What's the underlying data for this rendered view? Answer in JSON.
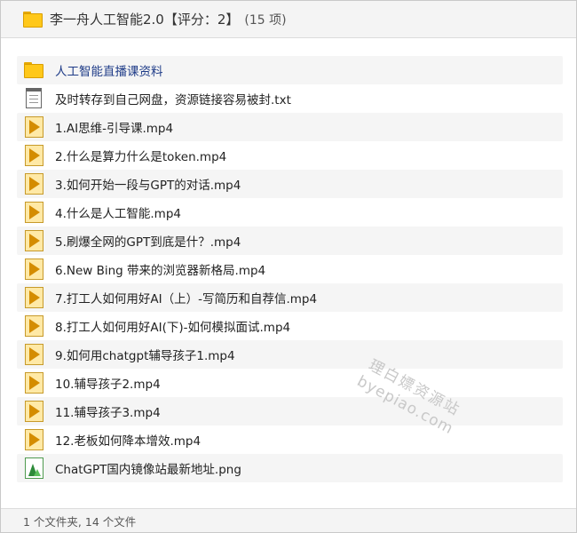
{
  "header": {
    "icon": "folder-icon",
    "title": "李一舟人工智能2.0【评分：2】",
    "count": "(15 项)"
  },
  "files": [
    {
      "name": "人工智能直播课资料",
      "type": "folder",
      "icon": "folder-icon"
    },
    {
      "name": "及时转存到自己网盘，资源链接容易被封.txt",
      "type": "txt",
      "icon": "text-file-icon"
    },
    {
      "name": "1.AI思维-引导课.mp4",
      "type": "video",
      "icon": "video-file-icon"
    },
    {
      "name": "2.什么是算力什么是token.mp4",
      "type": "video",
      "icon": "video-file-icon"
    },
    {
      "name": "3.如何开始一段与GPT的对话.mp4",
      "type": "video",
      "icon": "video-file-icon"
    },
    {
      "name": "4.什么是人工智能.mp4",
      "type": "video",
      "icon": "video-file-icon"
    },
    {
      "name": "5.刷爆全网的GPT到底是什？.mp4",
      "type": "video",
      "icon": "video-file-icon"
    },
    {
      "name": "6.New Bing 带来的浏览器新格局.mp4",
      "type": "video",
      "icon": "video-file-icon"
    },
    {
      "name": "7.打工人如何用好AI（上）-写简历和自荐信.mp4",
      "type": "video",
      "icon": "video-file-icon"
    },
    {
      "name": "8.打工人如何用好AI(下)-如何模拟面试.mp4",
      "type": "video",
      "icon": "video-file-icon"
    },
    {
      "name": "9.如何用chatgpt辅导孩子1.mp4",
      "type": "video",
      "icon": "video-file-icon"
    },
    {
      "name": "10.辅导孩子2.mp4",
      "type": "video",
      "icon": "video-file-icon"
    },
    {
      "name": "11.辅导孩子3.mp4",
      "type": "video",
      "icon": "video-file-icon"
    },
    {
      "name": "12.老板如何降本增效.mp4",
      "type": "video",
      "icon": "video-file-icon"
    },
    {
      "name": "ChatGPT国内镜像站最新地址.png",
      "type": "image",
      "icon": "image-file-icon"
    }
  ],
  "watermark": {
    "line1": "理白嫖资源站",
    "line2": "byepiao.com"
  },
  "footer": {
    "summary": "1 个文件夹, 14 个文件"
  },
  "colors": {
    "folder_label": "#1f3c88",
    "row_alt": "#f5f5f5",
    "header_bg": "#f4f4f4"
  }
}
